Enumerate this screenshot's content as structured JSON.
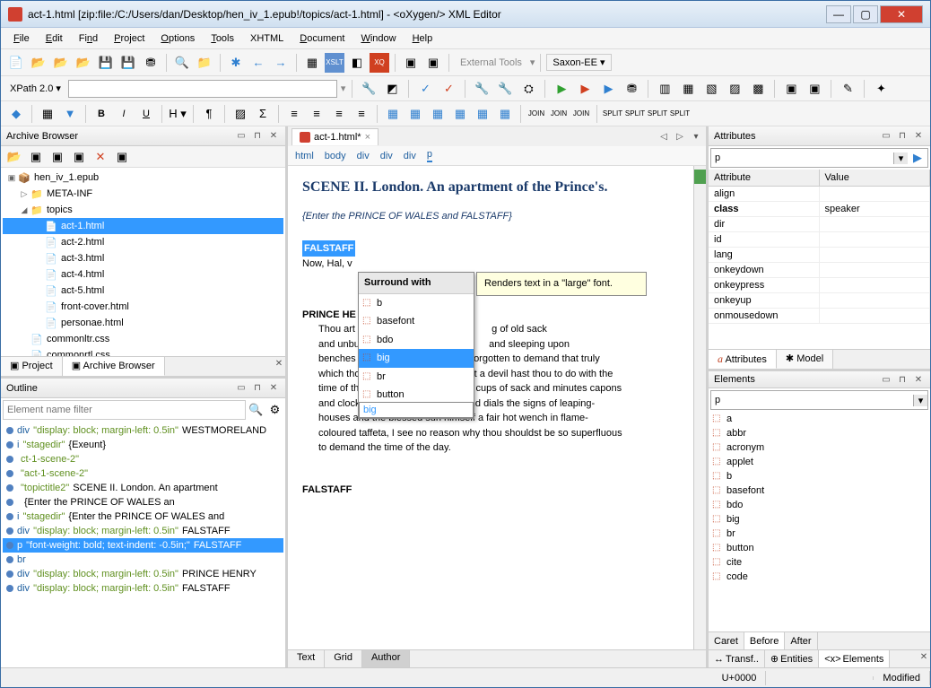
{
  "title": "act-1.html [zip:file:/C:/Users/dan/Desktop/hen_iv_1.epub!/topics/act-1.html] - <oXygen/> XML Editor",
  "menu": {
    "file": "File",
    "edit": "Edit",
    "find": "Find",
    "project": "Project",
    "options": "Options",
    "tools": "Tools",
    "xhtml": "XHTML",
    "document": "Document",
    "window": "Window",
    "help": "Help"
  },
  "external_tools": "External Tools",
  "engine": "Saxon-EE",
  "xpath_label": "XPath 2.0",
  "archive_browser": {
    "title": "Archive Browser",
    "root": "hen_iv_1.epub",
    "meta": "META-INF",
    "topics": "topics",
    "files": [
      "act-1.html",
      "act-2.html",
      "act-3.html",
      "act-4.html",
      "act-5.html",
      "front-cover.html",
      "personae.html"
    ],
    "css1": "commonltr.css",
    "css2": "commonrtl.css"
  },
  "left_tabs": {
    "project": "Project",
    "archive": "Archive Browser"
  },
  "outline": {
    "title": "Outline",
    "filter_placeholder": "Element name filter",
    "items": [
      {
        "tag": "div",
        "style": "\"display: block; margin-left: 0.5in\"",
        "text": " WESTMORELAND"
      },
      {
        "tag": "i",
        "style": "\"stagedir\"",
        "text": " {Exeunt}"
      },
      {
        "tag": "",
        "style": "ct-1-scene-2\"",
        "text": ""
      },
      {
        "tag": "",
        "style": "\"act-1-scene-2\"",
        "text": ""
      },
      {
        "tag": "",
        "style": "\"topictitle2\"",
        "text": " SCENE II. London. An apartment"
      },
      {
        "tag": "",
        "style": "",
        "text": " {Enter the PRINCE OF WALES an"
      },
      {
        "tag": "i",
        "style": "\"stagedir\"",
        "text": " {Enter the PRINCE OF WALES and"
      },
      {
        "tag": "div",
        "style": "\"display: block; margin-left: 0.5in\"",
        "text": " FALSTAFF"
      },
      {
        "tag": "p",
        "style": "\"font-weight: bold; text-indent: -0.5in;\"",
        "text": " FALSTAFF",
        "sel": true
      },
      {
        "tag": "br",
        "style": "",
        "text": ""
      },
      {
        "tag": "div",
        "style": "\"display: block; margin-left: 0.5in\"",
        "text": " PRINCE HENRY"
      },
      {
        "tag": "div",
        "style": "\"display: block; margin-left: 0.5in\"",
        "text": " FALSTAFF"
      }
    ]
  },
  "editor": {
    "tab": "act-1.html*",
    "breadcrumb": [
      "html",
      "body",
      "div",
      "div",
      "div",
      "p"
    ],
    "scene_title": "SCENE II. London. An apartment of the Prince's.",
    "stage_dir": "{Enter the PRINCE OF WALES and FALSTAFF}",
    "falstaff": "FALSTAFF",
    "falstaff_line": "Now, Hal, v",
    "prince": "PRINCE HE",
    "prince_speech": "Thou art so fat-witted, with drinking of old sack and unbuttoning thee after supper and sleeping upon benches after noon, that thou hast forgotten to demand that truly which thou wouldst truly know. What a devil hast thou to do with the time of the day? Unless hours were cups of sack and minutes capons and clocks the tongues of bawds and dials the signs of leaping-houses and the blessed sun himself a fair hot wench in flame-coloured taffeta, I see no reason why thou shouldst be so superfluous to demand the time of the day.",
    "falstaff2": "FALSTAFF",
    "modes": {
      "text": "Text",
      "grid": "Grid",
      "author": "Author"
    }
  },
  "popup": {
    "title": "Surround with",
    "items": [
      "b",
      "basefont",
      "bdo",
      "big",
      "br",
      "button"
    ],
    "selected": "big",
    "input": "big",
    "tooltip": "Renders text in a \"large\" font."
  },
  "attributes": {
    "title": "Attributes",
    "elem": "p",
    "cols": {
      "attr": "Attribute",
      "val": "Value"
    },
    "rows": [
      {
        "a": "align",
        "v": ""
      },
      {
        "a": "class",
        "v": "speaker",
        "bold": true
      },
      {
        "a": "dir",
        "v": ""
      },
      {
        "a": "id",
        "v": ""
      },
      {
        "a": "lang",
        "v": ""
      },
      {
        "a": "onkeydown",
        "v": ""
      },
      {
        "a": "onkeypress",
        "v": ""
      },
      {
        "a": "onkeyup",
        "v": ""
      },
      {
        "a": "onmousedown",
        "v": ""
      }
    ],
    "tabs": {
      "attr": "Attributes",
      "model": "Model"
    }
  },
  "elements": {
    "title": "Elements",
    "elem": "p",
    "items": [
      "a",
      "abbr",
      "acronym",
      "applet",
      "b",
      "basefont",
      "bdo",
      "big",
      "br",
      "button",
      "cite",
      "code"
    ],
    "caret_tabs": {
      "caret": "Caret",
      "before": "Before",
      "after": "After"
    },
    "bottom_tabs": {
      "transf": "Transf..",
      "entities": "Entities",
      "elements": "Elements"
    }
  },
  "status": {
    "unicode": "U+0000",
    "modified": "Modified"
  }
}
